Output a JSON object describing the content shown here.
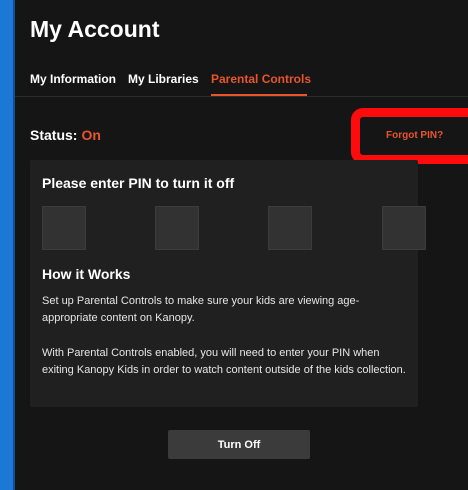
{
  "page": {
    "title": "My Account"
  },
  "tabs": [
    {
      "label": "My Information"
    },
    {
      "label": "My Libraries"
    },
    {
      "label": "Parental Controls",
      "active": true
    }
  ],
  "status": {
    "label": "Status:",
    "value": "On"
  },
  "forgot_pin_label": "Forgot PIN?",
  "pin_prompt": "Please enter PIN to turn it off",
  "pin": {
    "digits": 4,
    "values": [
      "",
      "",
      "",
      ""
    ]
  },
  "how_it_works": {
    "title": "How it Works",
    "paragraph1": "Set up Parental Controls to make sure your kids are viewing age-appropriate content on Kanopy.",
    "paragraph2": "With Parental Controls enabled, you will need to enter your PIN when exiting Kanopy Kids in order to watch content outside of the kids collection."
  },
  "turn_off_label": "Turn Off",
  "colors": {
    "accent": "#e8552d",
    "highlight": "#ff0b0b",
    "background": "#151515",
    "outer": "#1b78d4"
  }
}
